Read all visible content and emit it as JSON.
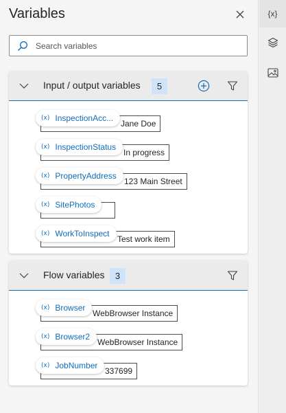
{
  "panel": {
    "title": "Variables",
    "search_placeholder": "Search variables"
  },
  "rail": {
    "variables_icon_text": "{x}"
  },
  "io_section": {
    "title": "Input / output variables",
    "count": "5",
    "items": [
      {
        "name": "InspectionAcc...",
        "value": "Jane Doe"
      },
      {
        "name": "InspectionStatus",
        "value": "In progress"
      },
      {
        "name": "PropertyAddress",
        "value": "123 Main Street"
      },
      {
        "name": "SitePhotos",
        "value": ""
      },
      {
        "name": "WorkToInspect",
        "value": "Test work item"
      }
    ]
  },
  "flow_section": {
    "title": "Flow variables",
    "count": "3",
    "items": [
      {
        "name": "Browser",
        "value": "WebBrowser Instance"
      },
      {
        "name": "Browser2",
        "value": "WebBrowser Instance"
      },
      {
        "name": "JobNumber",
        "value": "337699"
      }
    ]
  },
  "pill_icon_text": "(x)",
  "colors": {
    "accent": "#0f6cbd",
    "badge_bg": "#cfe4fa",
    "header_bg": "#ebebeb"
  }
}
